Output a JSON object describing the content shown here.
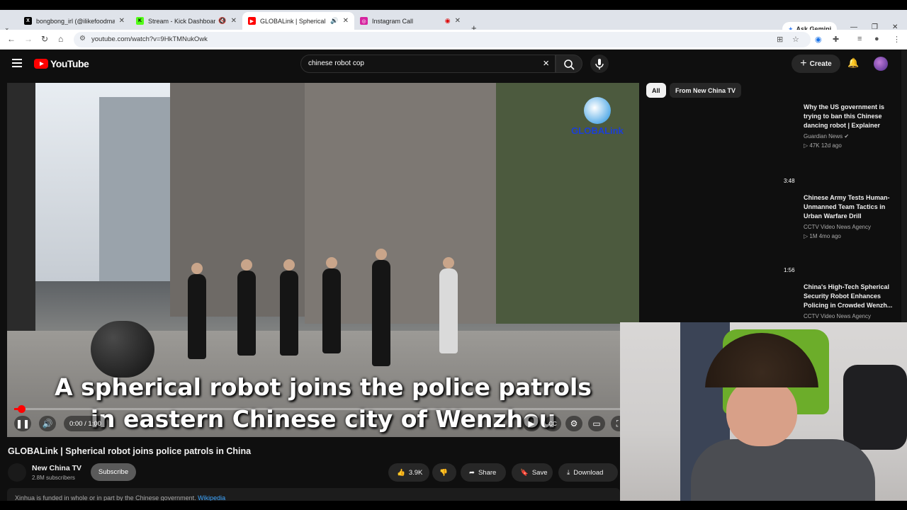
{
  "browser": {
    "tabs": [
      {
        "title": "bongbong_irl (@ilikefoodmany",
        "icon": "x-icon",
        "favcolor": "#000000",
        "active": false
      },
      {
        "title": "Stream - Kick Dashboard",
        "icon": "kick-icon",
        "favcolor": "#53fc18",
        "active": false
      },
      {
        "title": "GLOBALink | Spherical robo",
        "icon": "youtube-icon",
        "favcolor": "#ff0000",
        "active": true
      },
      {
        "title": "Instagram Call",
        "icon": "instagram-icon",
        "favcolor": "#d6249f",
        "active": false
      }
    ],
    "ask_gemini": "Ask Gemini",
    "url": "youtube.com/watch?v=9HkTMNukOwk"
  },
  "youtube": {
    "logo_text": "YouTube",
    "search_value": "chinese robot cop",
    "create_label": "Create"
  },
  "video": {
    "caption_line1": "A spherical robot joins the police patrols",
    "caption_line2": "in eastern Chinese city of Wenzhou",
    "watermark": "GLOBALink",
    "time": "0:00 / 1:00",
    "progress": 0,
    "title": "GLOBALink | Spherical robot joins police patrols in China",
    "channel": "New China TV",
    "subscribers": "2.8M subscribers",
    "subscribe_label": "Subscribe",
    "likes": "3.9K",
    "share_label": "Share",
    "save_label": "Save",
    "download_label": "Download",
    "notice_text": "Xinhua is funded in whole or in part by the Chinese government.",
    "notice_link": "Wikipedia"
  },
  "sidebar": {
    "chips": [
      "All",
      "From New China TV"
    ],
    "recommendations": [
      {
        "duration": "",
        "title": "Why the US government is trying to ban this Chinese dancing robot | Explainer",
        "channel": "Guardian News",
        "meta": "47K  12d ago"
      },
      {
        "duration": "3:48",
        "title": "Chinese Army Tests Human-Unmanned Team Tactics in Urban Warfare Drill",
        "channel": "CCTV Video News Agency",
        "meta": "1M  4mo ago"
      },
      {
        "duration": "1:56",
        "title": "China's High-Tech Spherical Security Robot Enhances Policing in Crowded Wenzh...",
        "channel": "CCTV Video News Agency",
        "meta": ""
      }
    ]
  },
  "colors": {
    "youtube_red": "#ff0000",
    "link_blue": "#3ea6ff",
    "background": "#0f0f0f"
  }
}
